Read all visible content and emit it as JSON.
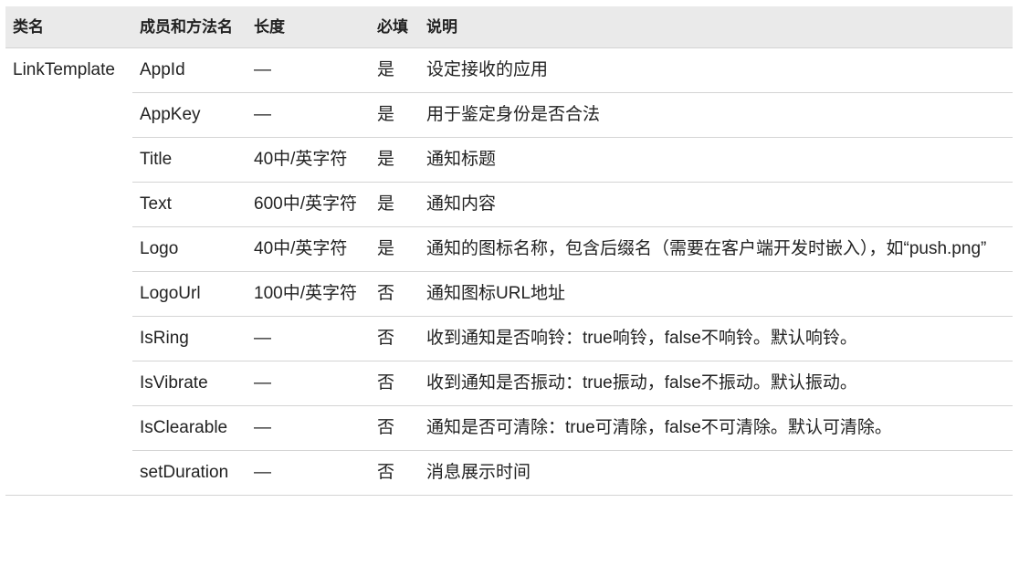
{
  "table": {
    "headers": {
      "class_name": "类名",
      "member": "成员和方法名",
      "length": "长度",
      "required": "必填",
      "description": "说明"
    },
    "rows": [
      {
        "class_name": "LinkTemplate",
        "member": "AppId",
        "length": "—",
        "required": "是",
        "description": "设定接收的应用"
      },
      {
        "class_name": "",
        "member": "AppKey",
        "length": "—",
        "required": "是",
        "description": "用于鉴定身份是否合法"
      },
      {
        "class_name": "",
        "member": "Title",
        "length": "40中/英字符",
        "required": "是",
        "description": "通知标题"
      },
      {
        "class_name": "",
        "member": "Text",
        "length": "600中/英字符",
        "required": "是",
        "description": "通知内容"
      },
      {
        "class_name": "",
        "member": "Logo",
        "length": "40中/英字符",
        "required": "是",
        "description": "通知的图标名称，包含后缀名（需要在客户端开发时嵌入），如“push.png”"
      },
      {
        "class_name": "",
        "member": "LogoUrl",
        "length": "100中/英字符",
        "required": "否",
        "description": "通知图标URL地址"
      },
      {
        "class_name": "",
        "member": "IsRing",
        "length": "—",
        "required": "否",
        "description": "收到通知是否响铃：true响铃，false不响铃。默认响铃。"
      },
      {
        "class_name": "",
        "member": "IsVibrate",
        "length": "—",
        "required": "否",
        "description": "收到通知是否振动：true振动，false不振动。默认振动。"
      },
      {
        "class_name": "",
        "member": "IsClearable",
        "length": "—",
        "required": "否",
        "description": "通知是否可清除：true可清除，false不可清除。默认可清除。"
      },
      {
        "class_name": "",
        "member": "setDuration",
        "length": "—",
        "required": "否",
        "description": "消息展示时间"
      }
    ]
  }
}
